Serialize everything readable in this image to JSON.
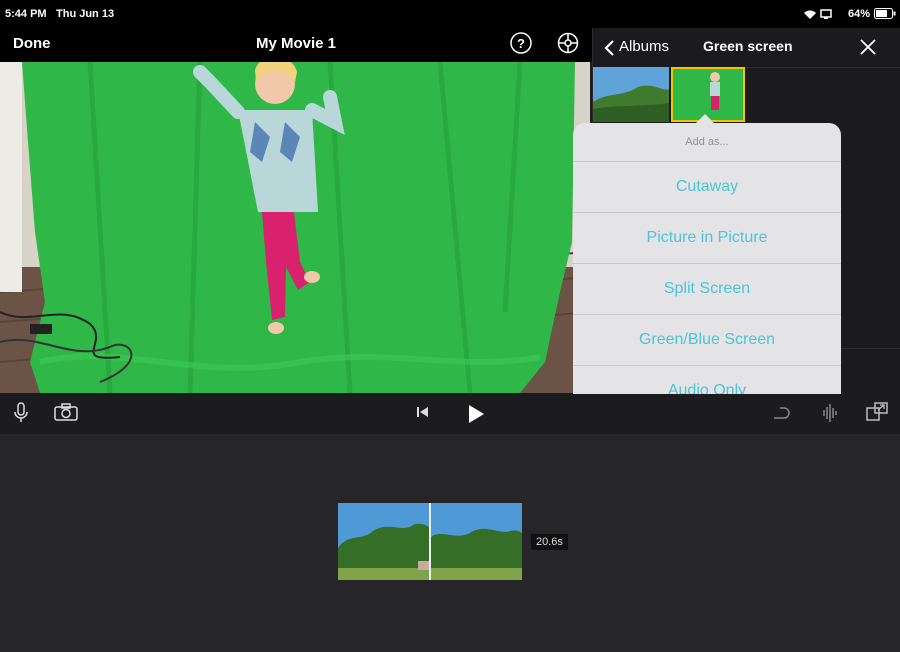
{
  "status_bar": {
    "time": "5:44 PM",
    "date": "Thu Jun 13",
    "battery": "64%"
  },
  "nav": {
    "done_label": "Done",
    "project_title": "My Movie 1"
  },
  "panel": {
    "back_label": "Albums",
    "album_title": "Green screen"
  },
  "popover": {
    "header": "Add as...",
    "options": [
      "Cutaway",
      "Picture in Picture",
      "Split Screen",
      "Green/Blue Screen",
      "Audio Only"
    ]
  },
  "timeline": {
    "clip_duration": "20.6s"
  },
  "colors": {
    "accent": "#4ec4d6",
    "selection": "#f5c400",
    "green_screen": "#2fb847"
  },
  "icons": [
    "back-chevron-icon",
    "close-icon",
    "help-icon",
    "settings-icon",
    "microphone-icon",
    "camera-icon",
    "skip-back-icon",
    "play-icon",
    "undo-icon",
    "audio-waveform-icon",
    "fullscreen-icon",
    "wifi-icon",
    "battery-icon"
  ]
}
